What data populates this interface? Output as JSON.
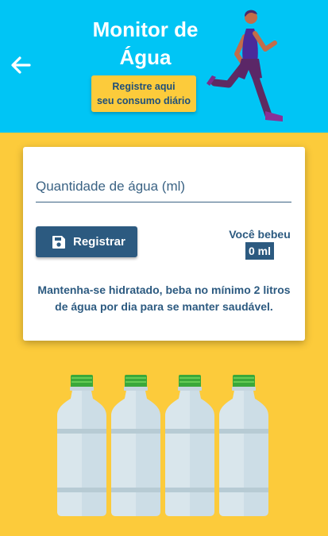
{
  "header": {
    "title_line1": "Monitor de",
    "title_line2": "Água",
    "badge_line1": "Registre aqui",
    "badge_line2": "seu consumo diário",
    "back_icon": "arrow-left-icon",
    "background": "#00c5f5"
  },
  "form": {
    "water_placeholder": "Quantidade de água (ml)",
    "water_value": "",
    "save_label": "Registrar",
    "save_icon": "floppy-disk-icon",
    "drank_label": "Você bebeu",
    "drank_value": "0 ml",
    "tip_text": "Mantenha-se hidratado, beba no mínimo 2 litros de água por dia para se manter saudável."
  },
  "bottles": {
    "count": 4,
    "filled": 0
  },
  "colors": {
    "page_background": "#fccb3b",
    "primary": "#2c5a80"
  }
}
